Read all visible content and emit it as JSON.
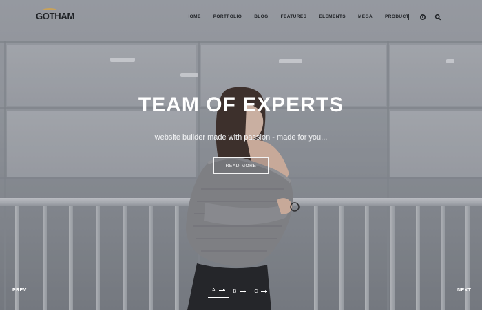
{
  "brand": {
    "name": "GOTHAM",
    "accent": "#c8a25a"
  },
  "nav": {
    "items": [
      "HOME",
      "PORTFOLIO",
      "BLOG",
      "FEATURES",
      "ELEMENTS",
      "MEGA",
      "PRODUCT"
    ],
    "icons": [
      "cart-icon",
      "search-icon"
    ]
  },
  "hero": {
    "headline": "TEAM OF EXPERTS",
    "subline": "website builder made with passion - made for you...",
    "cta_label": "READ MORE"
  },
  "slider": {
    "prev_label": "PREV",
    "next_label": "NEXT",
    "dots": [
      "A",
      "B",
      "C"
    ],
    "active_index": 0
  }
}
